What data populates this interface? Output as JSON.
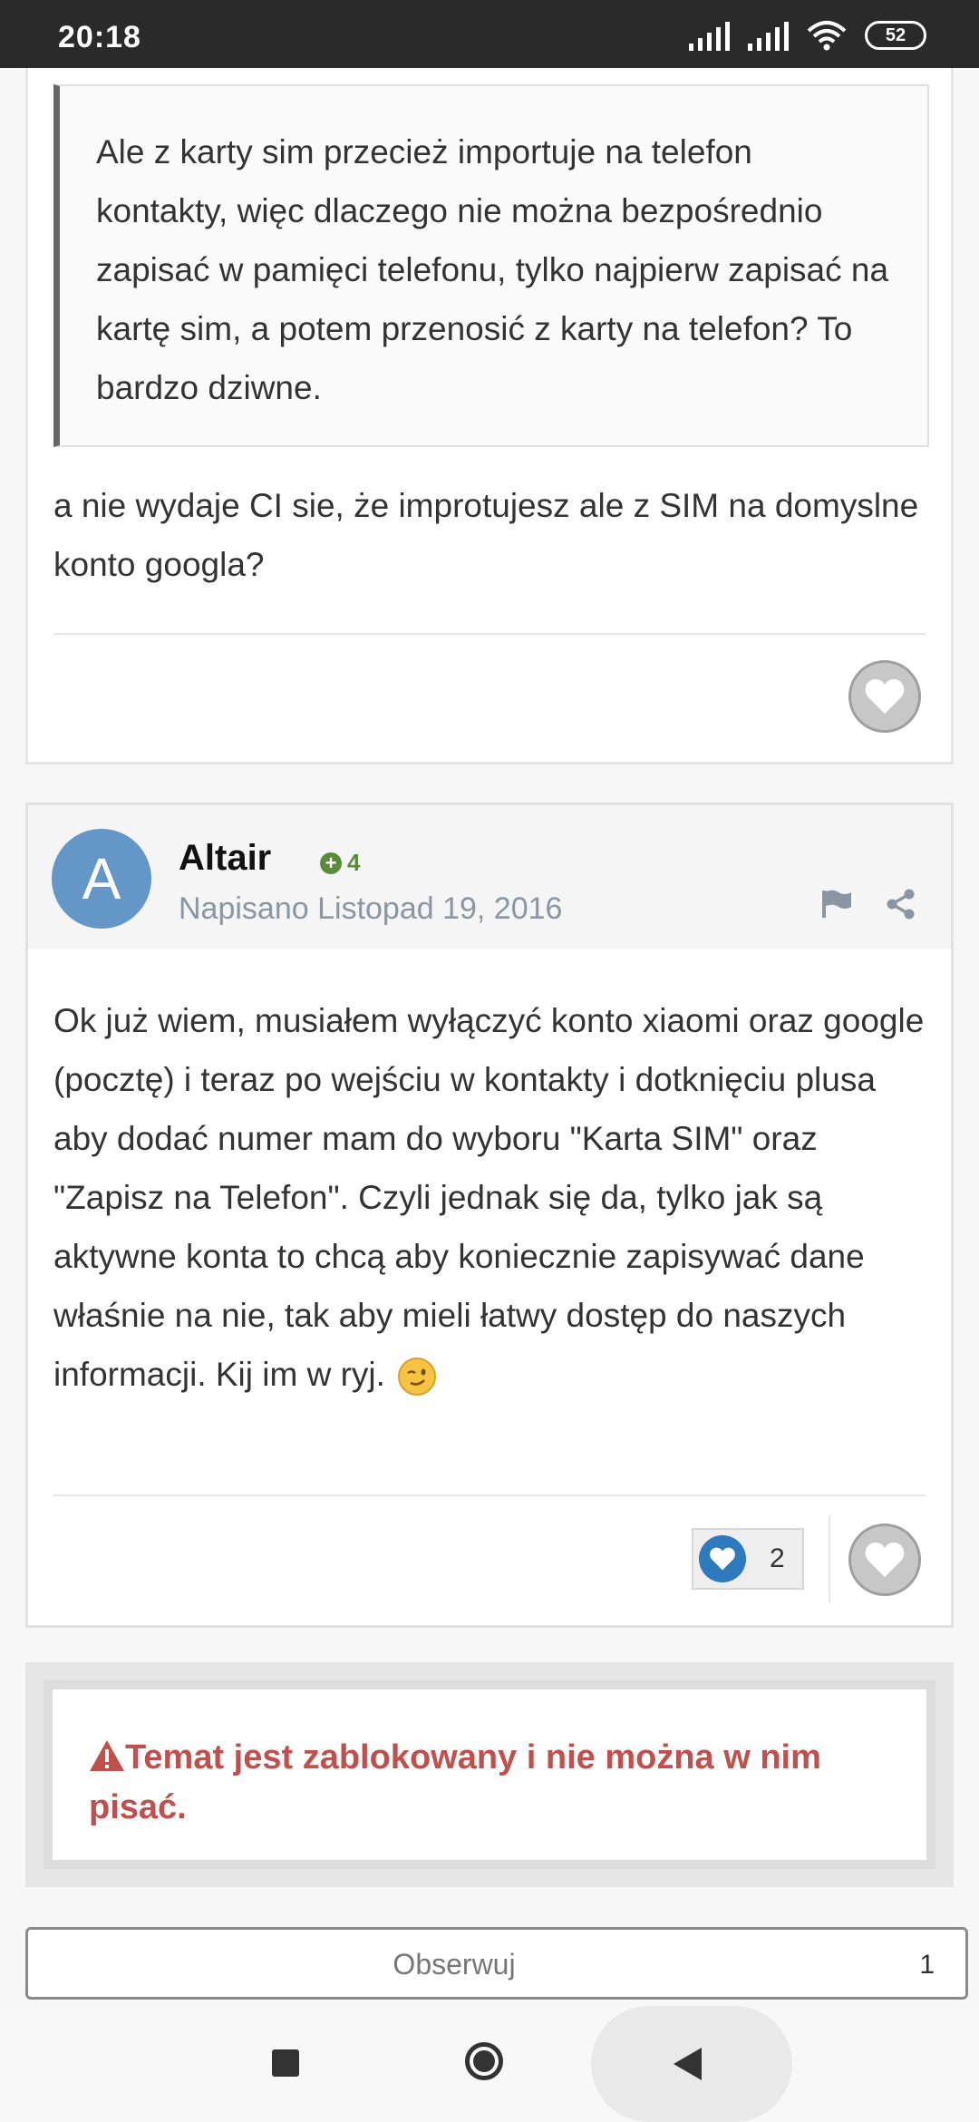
{
  "status_bar": {
    "time": "20:18",
    "battery": "52"
  },
  "post_prev": {
    "quote": "Ale z karty sim przecież importuje na telefon kontakty, więc dlaczego nie można bezpośrednio zapisać w pamięci telefonu, tylko najpierw zapisać na kartę sim, a potem przenosić z karty na telefon? To bardzo dziwne.",
    "text": "a nie wydaje CI sie, że improtujesz ale z SIM na domyslne konto googla?"
  },
  "post": {
    "avatar_letter": "A",
    "author": "Altair",
    "reputation": "4",
    "date": "Napisano Listopad 19, 2016",
    "body": "Ok już wiem, musiałem wyłączyć konto xiaomi oraz google (pocztę)  i teraz  po wejściu w kontakty i dotknięciu plusa aby dodać numer mam do wyboru \"Karta SIM\" oraz \"Zapisz na Telefon\". Czyli jednak się da, tylko jak są aktywne konta to chcą aby koniecznie zapisywać dane właśnie na nie, tak aby mieli łatwy dostęp do naszych informacji. Kij im w ryj.",
    "reaction_count": "2"
  },
  "locked": {
    "message": "Temat jest zablokowany i nie można w nim pisać."
  },
  "follow": {
    "label": "Obserwuj",
    "count": "1"
  },
  "colors": {
    "avatar": "#6496c8",
    "locked_text": "#c0504d",
    "reputation": "#5a8a3a",
    "reaction": "#2f79bf"
  },
  "icons": [
    "signal-icon",
    "wifi-icon",
    "battery-icon",
    "heart-icon",
    "flag-icon",
    "share-icon",
    "warning-icon",
    "wink-emoji-icon",
    "recents-icon",
    "home-icon",
    "back-icon"
  ]
}
